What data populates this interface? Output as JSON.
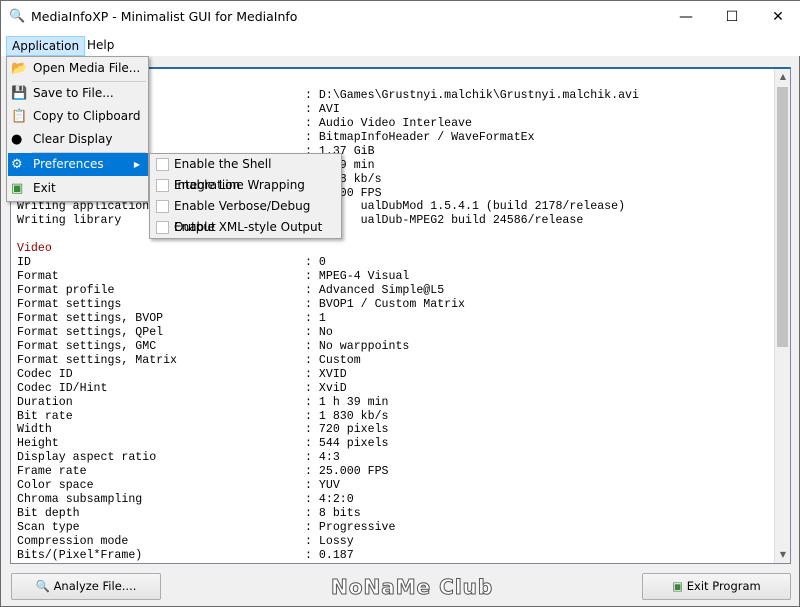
{
  "window": {
    "title": "MediaInfoXP - Minimalist GUI for MediaInfo",
    "app_icon": "magnifier-icon",
    "controls": [
      "minimize",
      "maximize",
      "close"
    ]
  },
  "menubar": {
    "items": [
      {
        "label": "Application"
      },
      {
        "label": "Help"
      }
    ]
  },
  "app_menu": {
    "items": [
      {
        "label": "Open Media File...",
        "icon": "folder-open-icon"
      },
      {
        "label": "Save to File...",
        "icon": "floppy-icon"
      },
      {
        "label": "Copy to Clipboard",
        "icon": "clipboard-icon"
      },
      {
        "label": "Clear Display",
        "icon": "bomb-icon"
      },
      {
        "label": "Preferences",
        "icon": "gear-icon",
        "highlighted": true
      },
      {
        "label": "Exit",
        "icon": "exit-door-icon"
      }
    ]
  },
  "preferences_submenu": {
    "items": [
      {
        "label": "Enable the Shell Integration",
        "checked": false
      },
      {
        "label": "Enable Line Wrapping",
        "checked": false
      },
      {
        "label": "Enable Verbose/Debug Output",
        "checked": false
      },
      {
        "label": "Enable XML-style Output",
        "checked": false
      }
    ]
  },
  "info": {
    "rows": [
      {
        "label": "",
        "value": ""
      },
      {
        "label": "",
        "value": ": D:\\Games\\Grustnyi.malchik\\Grustnyi.malchik.avi"
      },
      {
        "label": "",
        "value": ": AVI"
      },
      {
        "label": "",
        "value": ": Audio Video Interleave"
      },
      {
        "label": "",
        "value": ": BitmapInfoHeader / WaveFormatEx"
      },
      {
        "label": "",
        "value": ": 1.37 GiB"
      },
      {
        "label": "",
        "value": "    39 min",
        "pad": true
      },
      {
        "label": "",
        "value": "    58 kb/s",
        "pad": true
      },
      {
        "label": "",
        "value": "    000 FPS",
        "pad": true
      },
      {
        "label": "Writing application",
        "value": "        ualDubMod 1.5.4.1 (build 2178/release)"
      },
      {
        "label": "Writing library",
        "value": "        ualDub-MPEG2 build 24586/release"
      },
      {
        "label": "",
        "value": ""
      },
      {
        "label": "Video",
        "value": "",
        "section": true
      },
      {
        "label": "ID",
        "value": ": 0"
      },
      {
        "label": "Format",
        "value": ": MPEG-4 Visual"
      },
      {
        "label": "Format profile",
        "value": ": Advanced Simple@L5"
      },
      {
        "label": "Format settings",
        "value": ": BVOP1 / Custom Matrix"
      },
      {
        "label": "Format settings, BVOP",
        "value": ": 1"
      },
      {
        "label": "Format settings, QPel",
        "value": ": No"
      },
      {
        "label": "Format settings, GMC",
        "value": ": No warppoints"
      },
      {
        "label": "Format settings, Matrix",
        "value": ": Custom"
      },
      {
        "label": "Codec ID",
        "value": ": XVID"
      },
      {
        "label": "Codec ID/Hint",
        "value": ": XviD"
      },
      {
        "label": "Duration",
        "value": ": 1 h 39 min"
      },
      {
        "label": "Bit rate",
        "value": ": 1 830 kb/s"
      },
      {
        "label": "Width",
        "value": ": 720 pixels"
      },
      {
        "label": "Height",
        "value": ": 544 pixels"
      },
      {
        "label": "Display aspect ratio",
        "value": ": 4:3"
      },
      {
        "label": "Frame rate",
        "value": ": 25.000 FPS"
      },
      {
        "label": "Color space",
        "value": ": YUV"
      },
      {
        "label": "Chroma subsampling",
        "value": ": 4:2:0"
      },
      {
        "label": "Bit depth",
        "value": ": 8 bits"
      },
      {
        "label": "Scan type",
        "value": ": Progressive"
      },
      {
        "label": "Compression mode",
        "value": ": Lossy"
      },
      {
        "label": "Bits/(Pixel*Frame)",
        "value": ": 0.187"
      }
    ]
  },
  "footer": {
    "analyze_label": "Analyze File....",
    "exit_label": "Exit Program",
    "watermark": "NoNaMe Club"
  }
}
